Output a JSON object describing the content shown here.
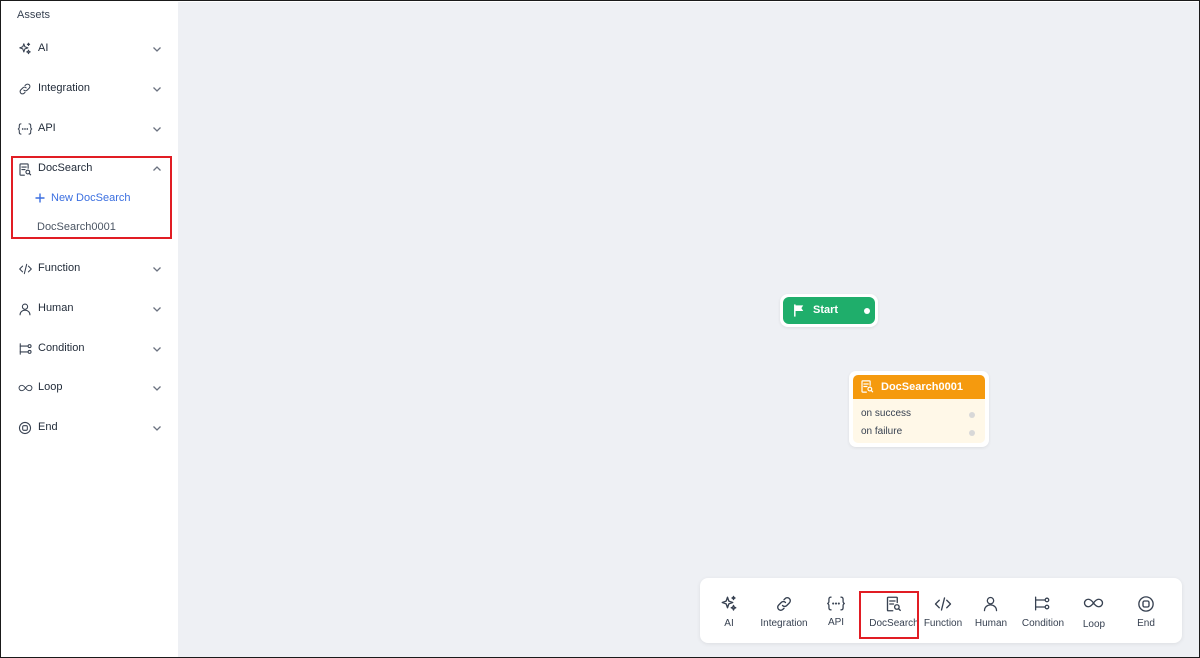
{
  "sidebar": {
    "title": "Assets",
    "categories": [
      {
        "label": "AI",
        "icon": "sparkles-icon",
        "expanded": false
      },
      {
        "label": "Integration",
        "icon": "link-icon",
        "expanded": false
      },
      {
        "label": "API",
        "icon": "braces-icon",
        "expanded": false
      },
      {
        "label": "DocSearch",
        "icon": "doc-search-icon",
        "expanded": true
      },
      {
        "label": "Function",
        "icon": "code-icon",
        "expanded": false
      },
      {
        "label": "Human",
        "icon": "user-icon",
        "expanded": false
      },
      {
        "label": "Condition",
        "icon": "branch-icon",
        "expanded": false
      },
      {
        "label": "Loop",
        "icon": "infinity-icon",
        "expanded": false
      },
      {
        "label": "End",
        "icon": "stop-circle-icon",
        "expanded": false
      }
    ],
    "docsearch": {
      "new_label": "New DocSearch",
      "items": [
        "DocSearch0001"
      ]
    }
  },
  "canvas": {
    "start_node": {
      "label": "Start",
      "color": "#1fae6b"
    },
    "doc_node": {
      "title": "DocSearch0001",
      "color": "#f59a0e",
      "outputs": [
        "on success",
        "on failure"
      ]
    }
  },
  "toolbar": {
    "items": [
      {
        "label": "AI",
        "icon": "sparkles-icon"
      },
      {
        "label": "Integration",
        "icon": "link-icon"
      },
      {
        "label": "API",
        "icon": "braces-icon"
      },
      {
        "label": "DocSearch",
        "icon": "doc-search-icon"
      },
      {
        "label": "Function",
        "icon": "code-icon"
      },
      {
        "label": "Human",
        "icon": "user-icon"
      },
      {
        "label": "Condition",
        "icon": "branch-icon"
      },
      {
        "label": "Loop",
        "icon": "infinity-icon"
      },
      {
        "label": "End",
        "icon": "stop-circle-icon"
      }
    ]
  },
  "colors": {
    "accent": "#3b6fe0",
    "highlight": "#e11d24",
    "canvas_bg": "#eef0f4"
  }
}
